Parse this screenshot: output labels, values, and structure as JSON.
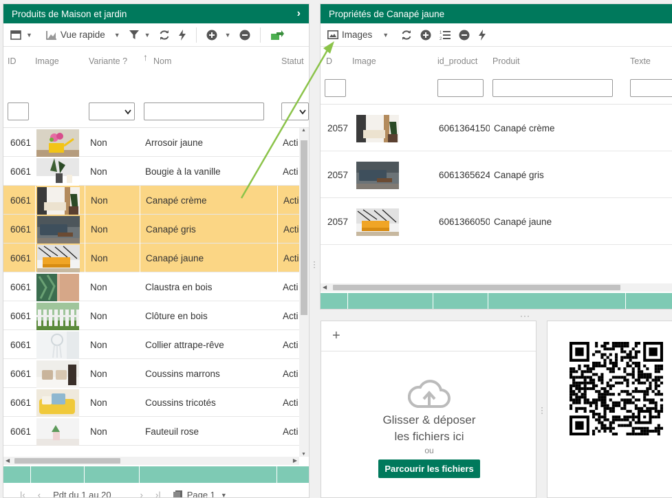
{
  "left_panel": {
    "title": "Produits de Maison et jardin",
    "toolbar": {
      "view_label": "Vue rapide"
    },
    "columns": {
      "id": "ID",
      "image": "Image",
      "variante": "Variante ?",
      "nom": "Nom",
      "statut": "Statut"
    },
    "rows": [
      {
        "id": "6061",
        "variante": "Non",
        "nom": "Arrosoir jaune",
        "statut": "Acti",
        "selected": false,
        "thumb": "watering-can"
      },
      {
        "id": "6061",
        "variante": "Non",
        "nom": "Bougie à la vanille",
        "statut": "Acti",
        "selected": false,
        "thumb": "candle"
      },
      {
        "id": "6061",
        "variante": "Non",
        "nom": "Canapé crème",
        "statut": "Acti",
        "selected": true,
        "thumb": "sofa-cream"
      },
      {
        "id": "6061",
        "variante": "Non",
        "nom": "Canapé gris",
        "statut": "Acti",
        "selected": true,
        "thumb": "sofa-grey"
      },
      {
        "id": "6061",
        "variante": "Non",
        "nom": "Canapé jaune",
        "statut": "Acti",
        "selected": true,
        "thumb": "sofa-yellow"
      },
      {
        "id": "6061",
        "variante": "Non",
        "nom": "Claustra en bois",
        "statut": "Acti",
        "selected": false,
        "thumb": "wood"
      },
      {
        "id": "6061",
        "variante": "Non",
        "nom": "Clôture en bois",
        "statut": "Acti",
        "selected": false,
        "thumb": "fence"
      },
      {
        "id": "6061",
        "variante": "Non",
        "nom": "Collier attrape-rêve",
        "statut": "Acti",
        "selected": false,
        "thumb": "dreamcatcher"
      },
      {
        "id": "6061",
        "variante": "Non",
        "nom": "Coussins marrons",
        "statut": "Acti",
        "selected": false,
        "thumb": "cushions-brown"
      },
      {
        "id": "6061",
        "variante": "Non",
        "nom": "Coussins tricotés",
        "statut": "Acti",
        "selected": false,
        "thumb": "cushions-knit"
      },
      {
        "id": "6061",
        "variante": "Non",
        "nom": "Fauteuil rose",
        "statut": "Acti",
        "selected": false,
        "thumb": "armchair"
      }
    ],
    "pager": {
      "range_text": "Pdt du 1 au 20",
      "page_label": "Page 1"
    }
  },
  "right_panel": {
    "title": "Propriétés de Canapé jaune",
    "toolbar": {
      "view_label": "Images"
    },
    "columns": {
      "id": "D",
      "image": "Image",
      "id_product": "id_product",
      "produit": "Produit",
      "texte": "Texte"
    },
    "rows": [
      {
        "id": "2057",
        "id_product": "6061364150",
        "produit": "Canapé crème",
        "thumb": "sofa-cream"
      },
      {
        "id": "2057",
        "id_product": "6061365624",
        "produit": "Canapé gris",
        "thumb": "sofa-grey"
      },
      {
        "id": "2057",
        "id_product": "6061366050",
        "produit": "Canapé jaune",
        "thumb": "sofa-yellow"
      }
    ]
  },
  "upload": {
    "add_symbol": "+",
    "drop_line1": "Glisser & déposer",
    "drop_line2": "les fichiers ici",
    "or_text": "ou",
    "browse_label": "Parcourir les fichiers"
  },
  "colors": {
    "brand": "#00795c",
    "selection": "#fbd685",
    "footer_band": "#7ecab4",
    "arrow": "#8bc34a"
  }
}
